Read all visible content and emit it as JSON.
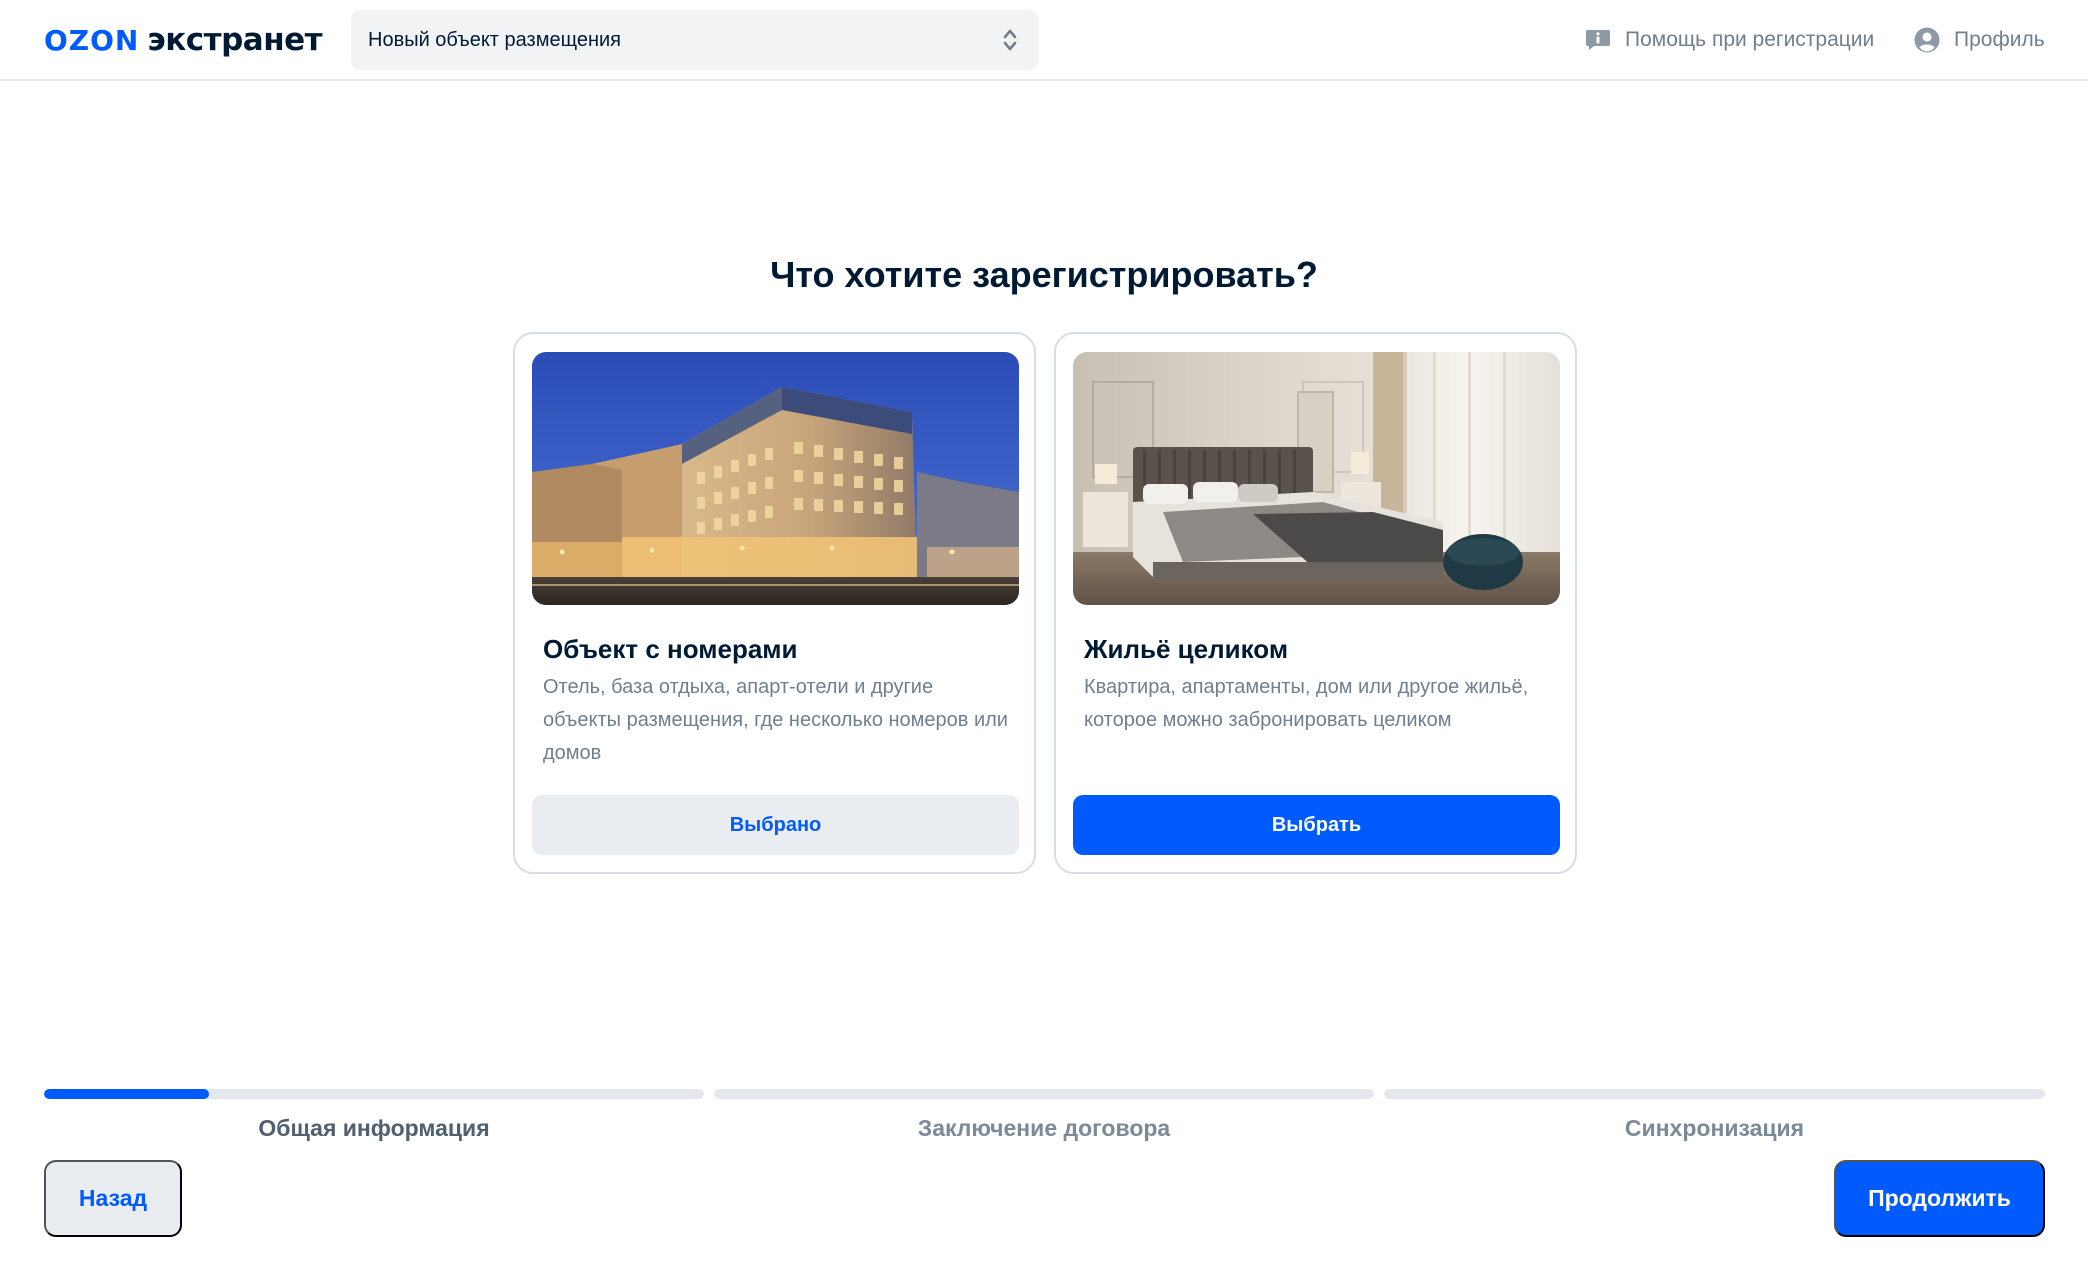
{
  "header": {
    "logo_brand": "OZON",
    "logo_product": "экстранет",
    "property_selector": {
      "value": "Новый объект размещения"
    },
    "help_label": "Помощь при регистрации",
    "profile_label": "Профиль"
  },
  "main": {
    "title": "Что хотите зарегистрировать?",
    "options": [
      {
        "title": "Объект с номерами",
        "description": "Отель, база отдыха, апарт-отели и другие объекты размещения, где несколько номеров или домов",
        "button_label": "Выбрано",
        "state": "selected"
      },
      {
        "title": "Жильё целиком",
        "description": "Квартира, апартаменты, дом или другое жильё, которое можно забронировать целиком",
        "button_label": "Выбрать",
        "state": "available"
      }
    ]
  },
  "progress": {
    "steps": [
      {
        "label": "Общая информация",
        "progress": 0.25,
        "active": true
      },
      {
        "label": "Заключение договора",
        "progress": 0,
        "active": false
      },
      {
        "label": "Синхронизация",
        "progress": 0,
        "active": false
      }
    ]
  },
  "footer": {
    "back_label": "Назад",
    "continue_label": "Продолжить"
  },
  "colors": {
    "accent": "#005bff",
    "text_primary": "#001a34",
    "text_secondary": "#707f8d",
    "surface_muted": "#e9edf1"
  }
}
